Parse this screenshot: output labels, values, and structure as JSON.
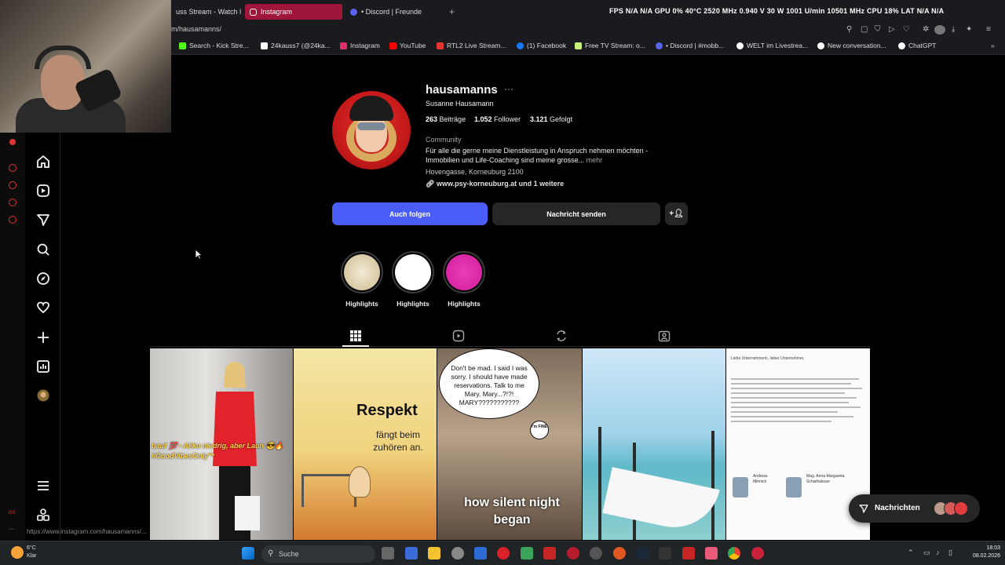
{
  "browser": {
    "tabs": [
      {
        "label": "uss Stream - Watch l"
      },
      {
        "label": "Instagram"
      },
      {
        "label": "• Discord | Freunde"
      }
    ],
    "new_tab": "+",
    "stats": "FPS N/A N/A   GPU 0% 40°C 2520 MHz 0.940 V 30 W 1001 U/min 10501 MHz   CPU 18%   LAT N/A N/A",
    "url": "m/hausamanns/",
    "bookmarks": [
      {
        "label": "Search - Kick Stre...",
        "color": "#53fc18"
      },
      {
        "label": "24kauss7 (@24ka...",
        "color": "#ffffff"
      },
      {
        "label": "Instagram",
        "color": "#e1306c"
      },
      {
        "label": "YouTube",
        "color": "#ff0000"
      },
      {
        "label": "RTL2 Live Stream...",
        "color": "#e3342f"
      },
      {
        "label": "(1) Facebook",
        "color": "#1877f2"
      },
      {
        "label": "Free TV Stream: o...",
        "color": "#c8f07a"
      },
      {
        "label": "• Discord | #mobb...",
        "color": "#5865f2"
      },
      {
        "label": "WELT im Livestrea...",
        "color": "#ffffff"
      },
      {
        "label": "New conversation...",
        "color": "#ffffff"
      },
      {
        "label": "ChatGPT",
        "color": "#ffffff"
      }
    ]
  },
  "profile": {
    "username": "hausamanns",
    "more": "···",
    "fullname": "Susanne Hausamann",
    "posts_count": "263",
    "posts_label": "Beiträge",
    "followers_count": "1.052",
    "followers_label": "Follower",
    "following_count": "3.121",
    "following_label": "Gefolgt",
    "category": "Community",
    "bio_line1": "Für alle die gerne meine Dienstleistung in Anspruch nehmen möchten -",
    "bio_line2": "Immobilien und Life-Coaching sind meine grosse...",
    "bio_more": "mehr",
    "address": "Hovengasse, Korneuburg 2100",
    "link": "www.psy-korneuburg.at und 1 weitere",
    "follow_button": "Auch folgen",
    "message_button": "Nachricht senden",
    "highlights": [
      {
        "label": "Highlights"
      },
      {
        "label": "Highlights"
      },
      {
        "label": "Highlights"
      }
    ]
  },
  "posts": {
    "p1_text": "bauf 💯 • Akku niedrig, aber Laun 😎🔥 #GoodVibesOnly\"*",
    "p2_title": "Respekt",
    "p2_sub": "fängt beim zuhören an.",
    "p3_bubble": "Don't be mad. I said I was sorry. I should have made reservations. Talk to me Mary. Mary...?!?! MARY???????????",
    "p3_fine": "I'm FINE",
    "p3_bottom": "how silent night began",
    "p5_doc": "Liebe Unternehmerin, lieber Unternehmer,",
    "p5_name1": "Andreas Minnich",
    "p5_name2": "Mag. Anna-Margareta Schwihaleuer"
  },
  "messages_button": "Nachrichten",
  "status_url": "https://www.instagram.com/hausamanns/...",
  "taskbar": {
    "weather_temp": "6°C",
    "weather_desc": "Klar",
    "search": "Suche",
    "time": "18:03",
    "date": "08.02.2026"
  },
  "colors": {
    "accent": "#4a5df9",
    "tab_active": "#a0163a"
  }
}
